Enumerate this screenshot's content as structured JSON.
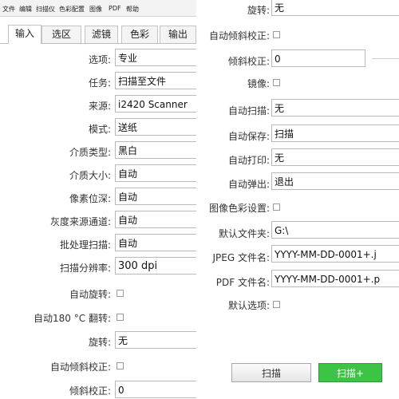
{
  "menu": [
    "文件",
    "编辑",
    "扫描仪",
    "色彩配置",
    "图像",
    "PDF",
    "帮助"
  ],
  "tabs": [
    "输入",
    "选区",
    "滤镜",
    "色彩",
    "输出"
  ],
  "left_form": [
    {
      "label": "选项:",
      "value": "专业"
    },
    {
      "label": "任务:",
      "value": "扫描至文件"
    },
    {
      "label": "来源:",
      "value": "i2420 Scanner"
    },
    {
      "label": "模式:",
      "value": "送纸"
    },
    {
      "label": "介质类型:",
      "value": "黑白"
    },
    {
      "label": "介质大小:",
      "value": "自动"
    },
    {
      "label": "像素位深:",
      "value": "自动"
    },
    {
      "label": "灰度来源通道:",
      "value": "自动"
    },
    {
      "label": "批处理扫描:",
      "value": "自动"
    },
    {
      "label": "扫描分辨率:",
      "value": "300 dpi"
    },
    {
      "label": "自动旋转:"
    },
    {
      "label": "自动180 °C 翻转:"
    },
    {
      "label": "旋转:",
      "value": "无"
    },
    {
      "label": "自动倾斜校正:"
    },
    {
      "label": "倾斜校正:",
      "value": "0"
    }
  ],
  "right_form": [
    {
      "label": "旋转:",
      "value": "无"
    },
    {
      "label": "自动倾斜校正:"
    },
    {
      "label": "倾斜校正:",
      "value": "0"
    },
    {
      "label": "镜像:"
    },
    {
      "label": "自动扫描:",
      "value": "无"
    },
    {
      "label": "自动保存:",
      "value": "扫描"
    },
    {
      "label": "自动打印:",
      "value": "无"
    },
    {
      "label": "自动弹出:",
      "value": "退出"
    },
    {
      "label": "图像色彩设置:"
    },
    {
      "label": "默认文件夹:",
      "value": "G:\\"
    },
    {
      "label": "JPEG 文件名:",
      "value": "YYYY-MM-DD-0001+.j"
    },
    {
      "label": "PDF 文件名:",
      "value": "YYYY-MM-DD-0001+.p"
    },
    {
      "label": "默认选项:"
    }
  ],
  "buttons": {
    "scan": "扫描",
    "scan_plus": "扫描+"
  },
  "colors": {
    "green_button": "#3cc445"
  }
}
